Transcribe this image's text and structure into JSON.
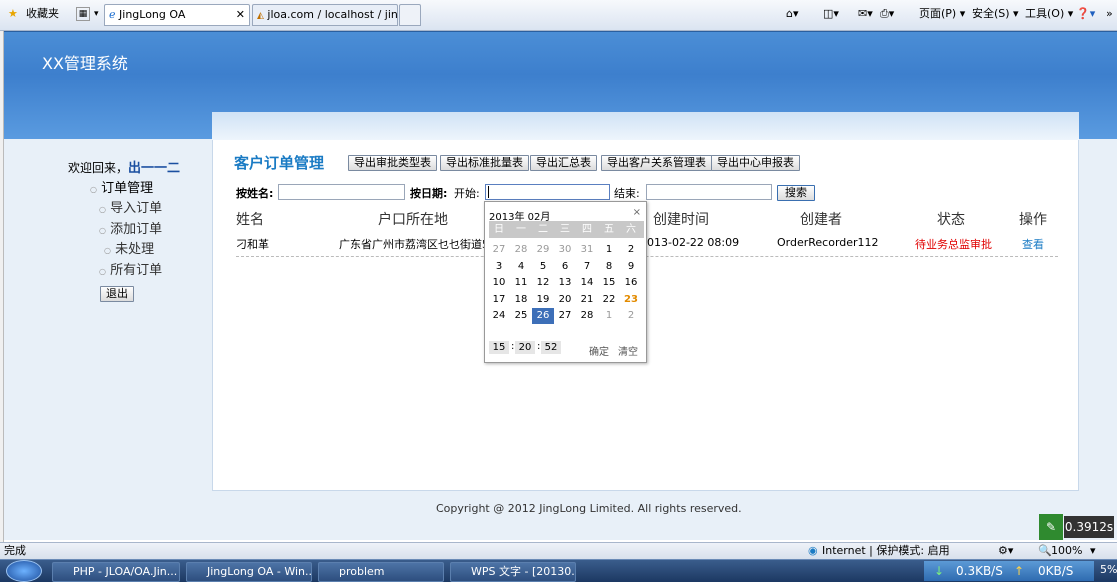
{
  "browser": {
    "favorites": "收藏夹",
    "tab1": "JingLong OA",
    "tab2": "jloa.com / localhost / jin...",
    "page_menu": "页面(P) ▾",
    "safety_menu": "安全(S) ▾",
    "tools_menu": "工具(O) ▾",
    "help_menu": "❓▾"
  },
  "system_title": "XX管理系统",
  "sidebar": {
    "welcome": "欢迎回来，",
    "username": "出一一二",
    "items": [
      "订单管理",
      "导入订单",
      "添加订单",
      "未处理",
      "所有订单"
    ],
    "logout": "退出"
  },
  "main": {
    "title": "客户订单管理",
    "buttons": [
      "导出审批类型表",
      "导出标准批量表",
      "导出汇总表",
      "导出客户关系管理表",
      "导出中心申报表"
    ],
    "search_name_label": "按姓名:",
    "search_date_label": "按日期:",
    "start_label": "开始:",
    "end_label": "结束:",
    "search_button": "搜索",
    "columns": [
      "姓名",
      "户口所在地",
      "创建时间",
      "创建者",
      "状态",
      "操作"
    ],
    "rows": [
      {
        "name": "刁和革",
        "address": "广东省广州市荔湾区乜乜街道5号",
        "created": "2013-02-22 08:09",
        "creator": "OrderRecorder112",
        "status": "待业务总监审批",
        "action": "查看"
      }
    ]
  },
  "calendar": {
    "header": "2013年 02月",
    "close": "×",
    "weekdays": [
      "日",
      "一",
      "二",
      "三",
      "四",
      "五",
      "六"
    ],
    "weeks": [
      [
        "27",
        "28",
        "29",
        "30",
        "31",
        "1",
        "2"
      ],
      [
        "3",
        "4",
        "5",
        "6",
        "7",
        "8",
        "9"
      ],
      [
        "10",
        "11",
        "12",
        "13",
        "14",
        "15",
        "16"
      ],
      [
        "17",
        "18",
        "19",
        "20",
        "21",
        "22",
        "23"
      ],
      [
        "24",
        "25",
        "26",
        "27",
        "28",
        "1",
        "2"
      ]
    ],
    "time": [
      "15",
      "20",
      "52"
    ],
    "confirm": "确定",
    "clear": "清空"
  },
  "footer": "Copyright @ 2012 JingLong Limited. All rights reserved.",
  "timer": "0.3912s",
  "statusbar": {
    "done": "完成",
    "zone": "Internet | 保护模式: 启用",
    "zoom": "100%"
  },
  "taskbar": {
    "tasks": [
      "PHP - JLOA/OA.Jin...",
      "JingLong OA - Win...",
      "problem",
      "WPS 文字 - [20130..."
    ],
    "down": "0.3KB/S",
    "up": "0KB/S",
    "pct": "5%"
  },
  "colors": {
    "accent": "#1a7bc4",
    "status_red": "#e00000",
    "highlight": "#3d6fb8"
  }
}
